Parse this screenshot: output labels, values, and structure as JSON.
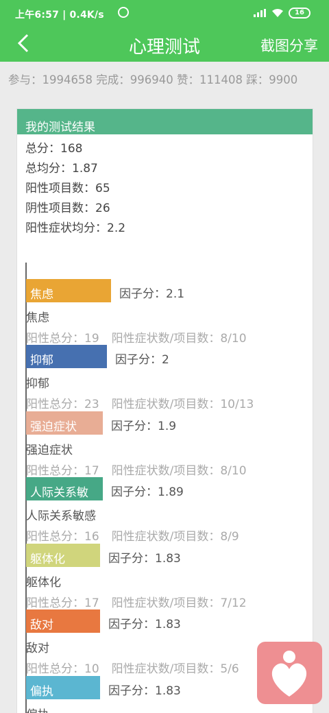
{
  "status_bar": {
    "time_speed": "上午6:57 | 0.4K/s",
    "battery": "16"
  },
  "app_bar": {
    "title": "心理测试",
    "share_label": "截图分享"
  },
  "stats": {
    "participants_label": "参与：",
    "participants": "1994658",
    "completed_label": "完成：",
    "completed": "996940",
    "likes_label": "赞：",
    "likes": "111408",
    "dislikes_label": "踩：",
    "dislikes": "9900"
  },
  "result": {
    "header": "我的测试结果",
    "summary": [
      "总分：168",
      "总均分：1.87",
      "阳性项目数：65",
      "阴性项目数：26",
      "阳性症状均分：2.2"
    ]
  },
  "factors": [
    {
      "bar_label": "焦虑",
      "score": "因子分：2.1",
      "name": "焦虑",
      "positive_total": "阳性总分：19",
      "ratio": "阳性症状数/项目数：8/10",
      "color": "#e9a534",
      "value": 2.1
    },
    {
      "bar_label": "抑郁",
      "score": "因子分：2",
      "name": "抑郁",
      "positive_total": "阳性总分：23",
      "ratio": "阳性症状数/项目数：10/13",
      "color": "#4670b0",
      "value": 2.0
    },
    {
      "bar_label": "强迫症状",
      "score": "因子分：1.9",
      "name": "强迫症状",
      "positive_total": "阳性总分：17",
      "ratio": "阳性症状数/项目数：8/10",
      "color": "#e8ad95",
      "value": 1.9
    },
    {
      "bar_label": "人际关系敏",
      "score": "因子分：1.89",
      "name": "人际关系敏感",
      "positive_total": "阳性总分：16",
      "ratio": "阳性症状数/项目数：8/9",
      "color": "#46a886",
      "value": 1.89
    },
    {
      "bar_label": "躯体化",
      "score": "因子分：1.83",
      "name": "躯体化",
      "positive_total": "阳性总分：17",
      "ratio": "阳性症状数/项目数：7/12",
      "color": "#d0d57c",
      "value": 1.83
    },
    {
      "bar_label": "敌对",
      "score": "因子分：1.83",
      "name": "敌对",
      "positive_total": "阳性总分：10",
      "ratio": "阳性症状数/项目数：5/6",
      "color": "#e87840",
      "value": 1.83
    },
    {
      "bar_label": "偏执",
      "score": "因子分：1.83",
      "name": "偏执",
      "positive_total": "",
      "ratio": "",
      "color": "#5bb6d1",
      "value": 1.83
    }
  ]
}
